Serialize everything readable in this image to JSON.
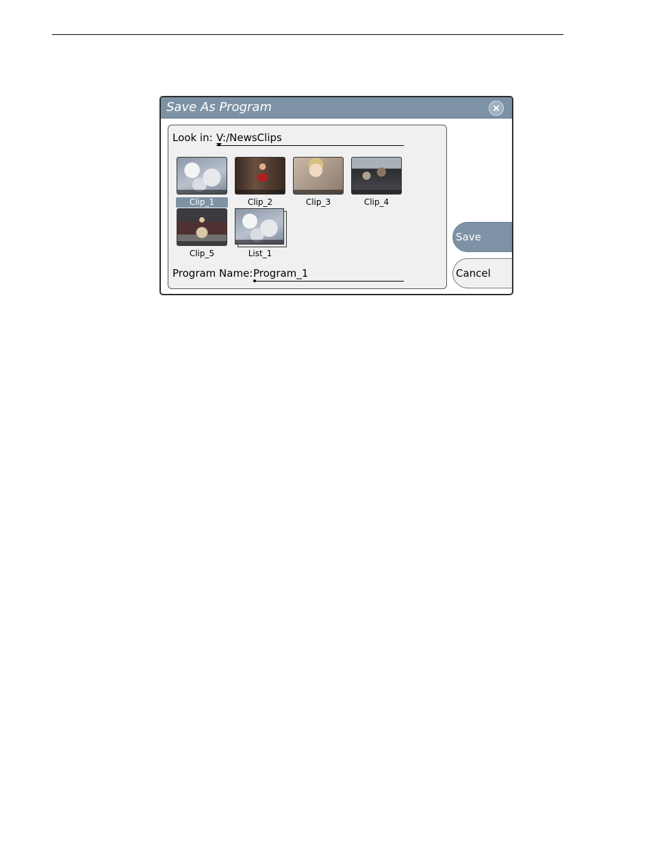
{
  "dialog": {
    "title": "Save As Program",
    "look_in_label": "Look in:",
    "path": "V:/NewsClips",
    "items": [
      {
        "label": "Clip_1",
        "selected": true
      },
      {
        "label": "Clip_2"
      },
      {
        "label": "Clip_3"
      },
      {
        "label": "Clip_4"
      },
      {
        "label": "Clip_5"
      },
      {
        "label": "List_1"
      }
    ],
    "program_name_label": "Program Name:",
    "program_name_value": "Program_1",
    "save_label": "Save",
    "cancel_label": "Cancel"
  },
  "colors": {
    "titlebar": "#7e92a6",
    "selection": "#7e92a6",
    "panel_bg": "#f0f0f0"
  },
  "icons": {
    "close": "close-icon",
    "dropdown": "chevron-down-icon"
  }
}
